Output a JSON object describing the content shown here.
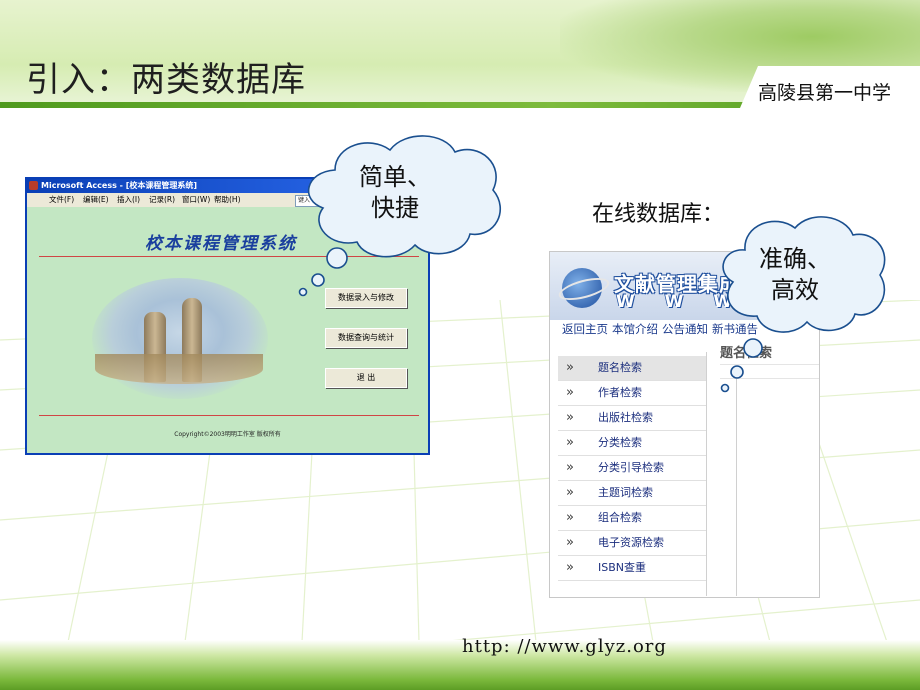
{
  "slide": {
    "title": "引入：两类数据库",
    "school": "高陵县第一中学",
    "url": "http: //www.glyz.org"
  },
  "access_window": {
    "title": "Microsoft Access - [校本课程管理系统]",
    "menu": [
      "文件(F)",
      "编辑(E)",
      "插入(I)",
      "记录(R)",
      "窗口(W)",
      "帮助(H)"
    ],
    "help_box": "键入",
    "form_title": "校本课程管理系统",
    "buttons": [
      "数据录入与修改",
      "数据查询与统计",
      "退  出"
    ],
    "copyright": "Copyright©2003明明工作室 版权所有"
  },
  "online_label": "在线数据库：",
  "library_site": {
    "banner_title": "文献管理集成",
    "banner_www": "W W W",
    "nav": [
      "返回主页",
      "本馆介绍",
      "公告通知",
      "新书通告"
    ],
    "search_head": "题名检索",
    "menu": [
      {
        "label": "题名检索",
        "active": true
      },
      {
        "label": "作者检索",
        "active": false
      },
      {
        "label": "出版社检索",
        "active": false
      },
      {
        "label": "分类检索",
        "active": false
      },
      {
        "label": "分类引导检索",
        "active": false
      },
      {
        "label": "主题词检索",
        "active": false
      },
      {
        "label": "组合检索",
        "active": false
      },
      {
        "label": "电子资源检索",
        "active": false
      },
      {
        "label": "ISBN查重",
        "active": false
      }
    ]
  },
  "clouds": [
    {
      "lines": [
        "简单、",
        "快捷"
      ]
    },
    {
      "lines": [
        "准确、",
        "高效"
      ]
    }
  ],
  "colors": {
    "header_green": "#d6ecb2",
    "accent_green": "#5c9d25",
    "access_bg": "#c3e7c3",
    "titlebar_blue": "#0a3fb5",
    "link_blue": "#1b3a8c"
  }
}
